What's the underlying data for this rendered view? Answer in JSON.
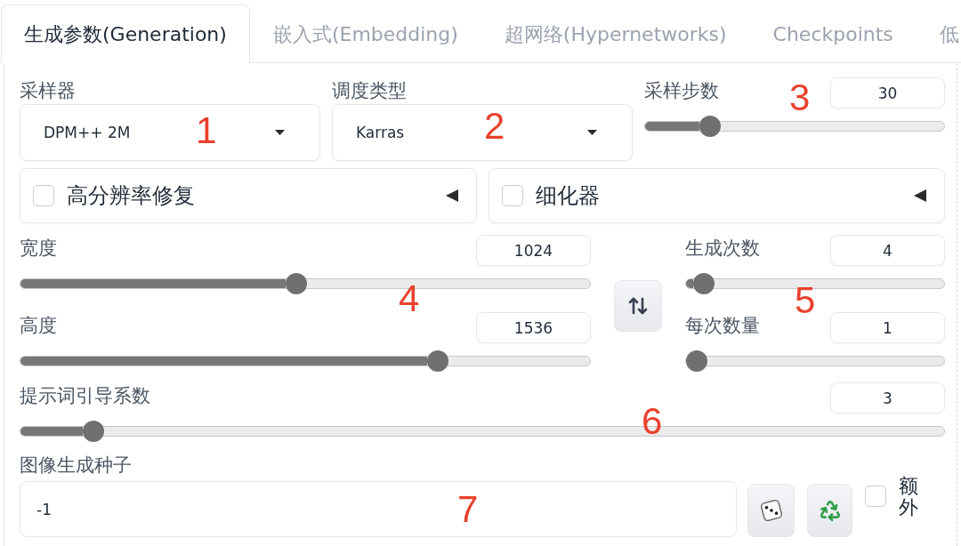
{
  "tabs": [
    {
      "label": "生成参数(Generation)",
      "selected": true
    },
    {
      "label": "嵌入式(Embedding)",
      "selected": false
    },
    {
      "label": "超网络(Hypernetworks)",
      "selected": false
    },
    {
      "label": "Checkpoints",
      "selected": false
    },
    {
      "label": "低",
      "selected": false
    }
  ],
  "sampler": {
    "label": "采样器",
    "value": "DPM++ 2M"
  },
  "schedule_type": {
    "label": "调度类型",
    "value": "Karras"
  },
  "sampling_steps": {
    "label": "采样步数",
    "value": "30",
    "level": 0.195
  },
  "accordions": [
    {
      "label": "高分辨率修复",
      "checked": false,
      "expanded": false
    },
    {
      "label": "细化器",
      "checked": false,
      "expanded": false
    }
  ],
  "width": {
    "label": "宽度",
    "value": "1024",
    "level": 0.484
  },
  "height": {
    "label": "高度",
    "value": "1536",
    "level": 0.742
  },
  "batch_count": {
    "label": "生成次数",
    "value": "4",
    "level": 0.03
  },
  "batch_size": {
    "label": "每次数量",
    "value": "1",
    "level": 0
  },
  "cfg_scale": {
    "label": "提示词引导系数",
    "value": "3",
    "level": 0.069
  },
  "seed": {
    "label": "图像生成种子",
    "value": "-1"
  },
  "extra": {
    "label": "额外",
    "checked": false
  },
  "annotations": [
    "1",
    "2",
    "3",
    "4",
    "5",
    "6",
    "7"
  ]
}
